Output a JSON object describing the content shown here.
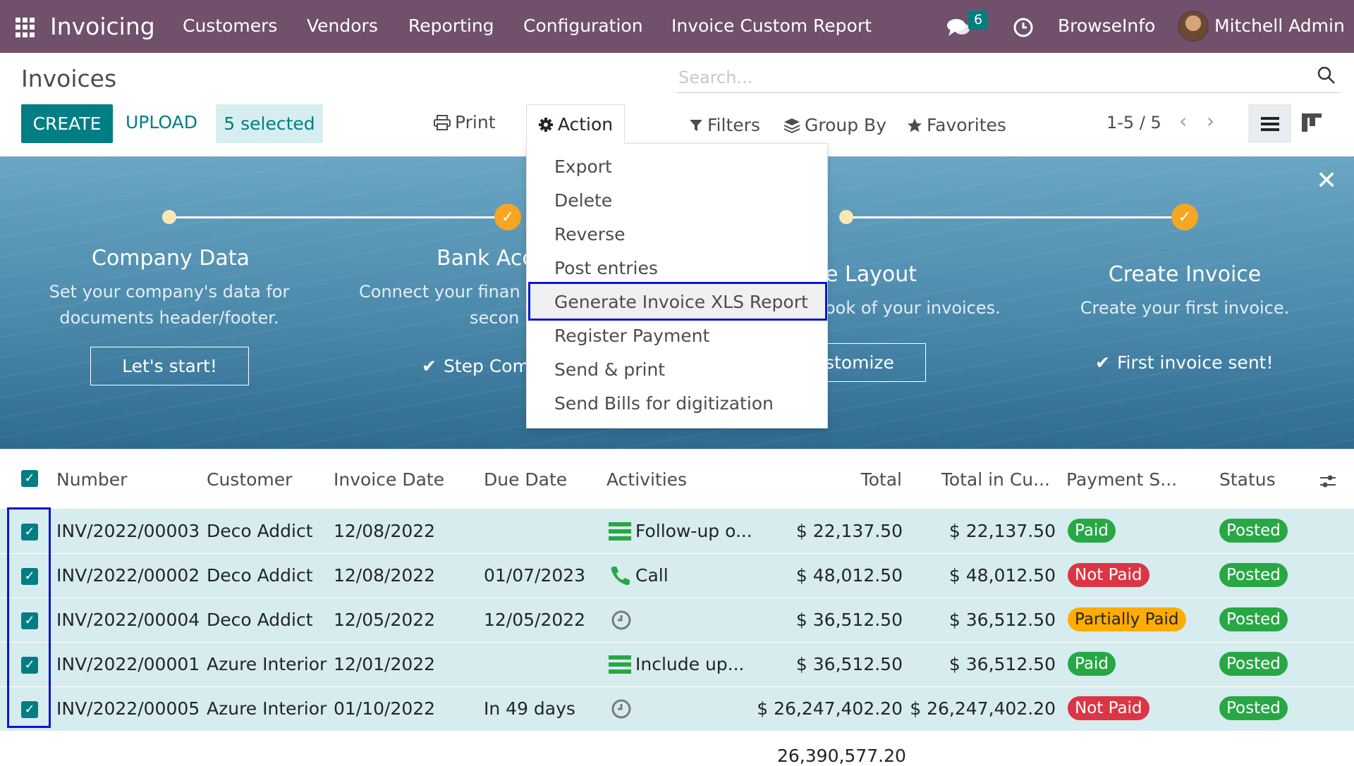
{
  "navbar": {
    "brand": "Invoicing",
    "menu": [
      "Customers",
      "Vendors",
      "Reporting",
      "Configuration",
      "Invoice Custom Report"
    ],
    "chat_count": "6",
    "company": "BrowseInfo",
    "user": "Mitchell Admin"
  },
  "control": {
    "title": "Invoices",
    "search_placeholder": "Search...",
    "create": "CREATE",
    "upload": "UPLOAD",
    "selected": "5 selected",
    "print": "Print",
    "action": "Action",
    "filters": "Filters",
    "group_by": "Group By",
    "favorites": "Favorites",
    "pager": "1-5 / 5"
  },
  "action_menu": [
    "Export",
    "Delete",
    "Reverse",
    "Post entries",
    "Generate Invoice XLS Report",
    "Register Payment",
    "Send & print",
    "Send Bills for digitization"
  ],
  "banner": {
    "steps": [
      {
        "title": "Company Data",
        "desc1": "Set your company's data for",
        "desc2": "documents header/footer.",
        "button": "Let's start!"
      },
      {
        "title": "Bank Acc",
        "desc1": "Connect your finan",
        "desc2": "secon",
        "done": "Step Com"
      },
      {
        "title": "e Layout",
        "desc1": "ook of your invoices.",
        "button": "stomize"
      },
      {
        "title": "Create Invoice",
        "desc1": "Create your first invoice.",
        "done": "First invoice sent!"
      }
    ]
  },
  "table": {
    "headers": {
      "number": "Number",
      "customer": "Customer",
      "invoice_date": "Invoice Date",
      "due_date": "Due Date",
      "activities": "Activities",
      "total": "Total",
      "total_cur": "Total in Cu...",
      "payment": "Payment S...",
      "status": "Status"
    },
    "rows": [
      {
        "number": "INV/2022/00003",
        "customer": "Deco Addict",
        "invoice_date": "12/08/2022",
        "due_date": "",
        "activity": "Follow-up o...",
        "activity_icon": "todo-icon",
        "total": "$ 22,137.50",
        "total_cur": "$ 22,137.50",
        "payment": "Paid",
        "status": "Posted"
      },
      {
        "number": "INV/2022/00002",
        "customer": "Deco Addict",
        "invoice_date": "12/08/2022",
        "due_date": "01/07/2023",
        "activity": "Call",
        "activity_icon": "phone-icon",
        "total": "$ 48,012.50",
        "total_cur": "$ 48,012.50",
        "payment": "Not Paid",
        "status": "Posted"
      },
      {
        "number": "INV/2022/00004",
        "customer": "Deco Addict",
        "invoice_date": "12/05/2022",
        "due_date": "12/05/2022",
        "activity": "",
        "activity_icon": "clock-icon",
        "total": "$ 36,512.50",
        "total_cur": "$ 36,512.50",
        "payment": "Partially Paid",
        "status": "Posted"
      },
      {
        "number": "INV/2022/00001",
        "customer": "Azure Interior",
        "invoice_date": "12/01/2022",
        "due_date": "",
        "activity": "Include up...",
        "activity_icon": "todo-icon",
        "total": "$ 36,512.50",
        "total_cur": "$ 36,512.50",
        "payment": "Paid",
        "status": "Posted"
      },
      {
        "number": "INV/2022/00005",
        "customer": "Azure Interior",
        "invoice_date": "01/10/2022",
        "due_date": "In 49 days",
        "activity": "",
        "activity_icon": "clock-icon",
        "total": "$ 26,247,402.20",
        "total_cur": "$ 26,247,402.20",
        "payment": "Not Paid",
        "status": "Posted"
      }
    ],
    "footer_total": "26,390,577.20"
  },
  "colors": {
    "navbar": "#71506b",
    "primary": "#017e84",
    "row_selected": "#d7ecef",
    "highlight": "#0a16d6"
  }
}
